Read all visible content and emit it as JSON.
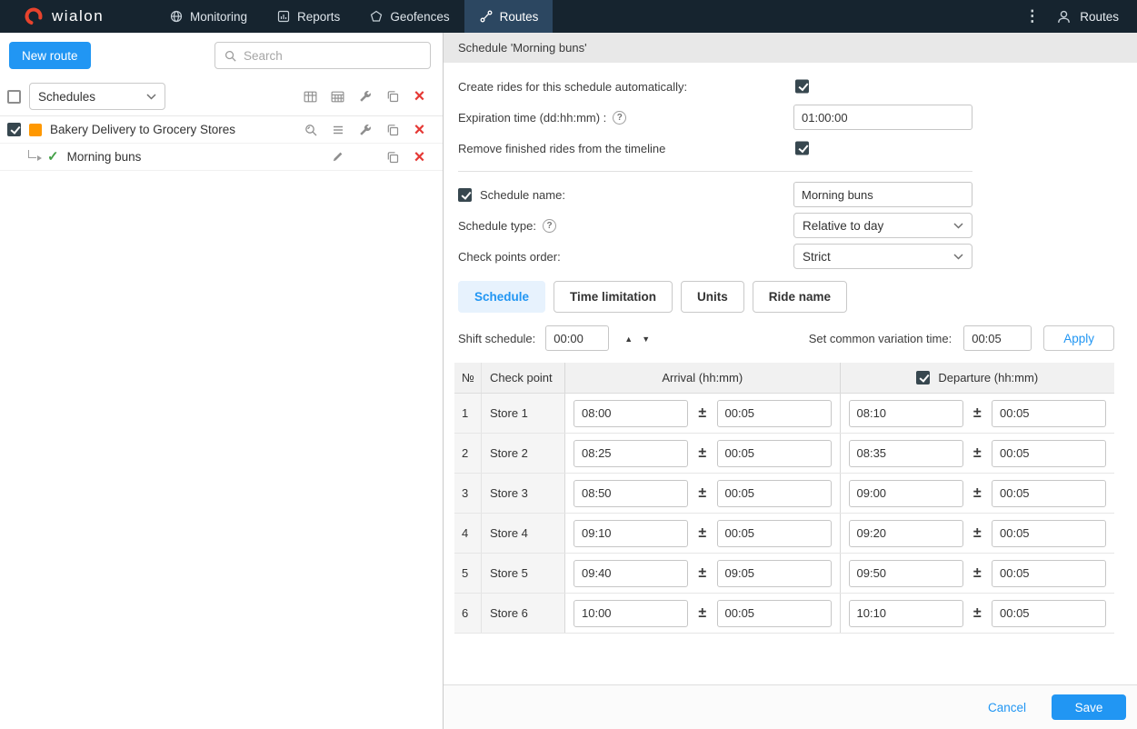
{
  "navbar": {
    "brand": "wialon",
    "items": [
      {
        "label": "Monitoring"
      },
      {
        "label": "Reports"
      },
      {
        "label": "Geofences"
      },
      {
        "label": "Routes",
        "active": true
      }
    ],
    "user_area_label": "Routes"
  },
  "left_panel": {
    "new_route_button": "New route",
    "search_placeholder": "Search",
    "mode_select": "Schedules",
    "route_row": {
      "name": "Bakery Delivery to Grocery Stores",
      "checked": true,
      "color": "#ff9800"
    },
    "schedule_row": {
      "name": "Morning buns",
      "active": true
    }
  },
  "panel": {
    "title": "Schedule 'Morning buns'",
    "create_rides": {
      "label": "Create rides for this schedule automatically:",
      "checked": true
    },
    "expiration": {
      "label": "Expiration time (dd:hh:mm) :",
      "value": "01:00:00"
    },
    "remove_finished": {
      "label": "Remove finished rides from the timeline",
      "checked": true
    },
    "schedule_name": {
      "label": "Schedule name:",
      "value": "Morning buns",
      "checked": true
    },
    "schedule_type": {
      "label": "Schedule type:",
      "value": "Relative to day"
    },
    "checkpoints_order": {
      "label": "Check points order:",
      "value": "Strict"
    },
    "tabs": [
      {
        "label": "Schedule",
        "active": true
      },
      {
        "label": "Time limitation"
      },
      {
        "label": "Units"
      },
      {
        "label": "Ride name"
      }
    ],
    "shift": {
      "label": "Shift schedule:",
      "value": "00:00"
    },
    "variation": {
      "label": "Set common variation time:",
      "value": "00:05",
      "apply": "Apply"
    },
    "table": {
      "col_num": "№",
      "col_checkpoint": "Check point",
      "col_arrival": "Arrival (hh:mm)",
      "col_departure": "Departure (hh:mm)",
      "departure_checked": true,
      "rows": [
        {
          "num": "1",
          "checkpoint": "Store 1",
          "arrival": "08:00",
          "arrival_var": "00:05",
          "departure": "08:10",
          "departure_var": "00:05"
        },
        {
          "num": "2",
          "checkpoint": "Store 2",
          "arrival": "08:25",
          "arrival_var": "00:05",
          "departure": "08:35",
          "departure_var": "00:05"
        },
        {
          "num": "3",
          "checkpoint": "Store 3",
          "arrival": "08:50",
          "arrival_var": "00:05",
          "departure": "09:00",
          "departure_var": "00:05"
        },
        {
          "num": "4",
          "checkpoint": "Store 4",
          "arrival": "09:10",
          "arrival_var": "00:05",
          "departure": "09:20",
          "departure_var": "00:05"
        },
        {
          "num": "5",
          "checkpoint": "Store 5",
          "arrival": "09:40",
          "arrival_var": "09:05",
          "departure": "09:50",
          "departure_var": "00:05"
        },
        {
          "num": "6",
          "checkpoint": "Store 6",
          "arrival": "10:00",
          "arrival_var": "00:05",
          "departure": "10:10",
          "departure_var": "00:05"
        }
      ]
    },
    "footer": {
      "cancel": "Cancel",
      "save": "Save"
    },
    "colors": {
      "accent": "#2196f3",
      "danger": "#e53935",
      "success": "#4caf50",
      "route_swatch": "#ff9800"
    }
  }
}
